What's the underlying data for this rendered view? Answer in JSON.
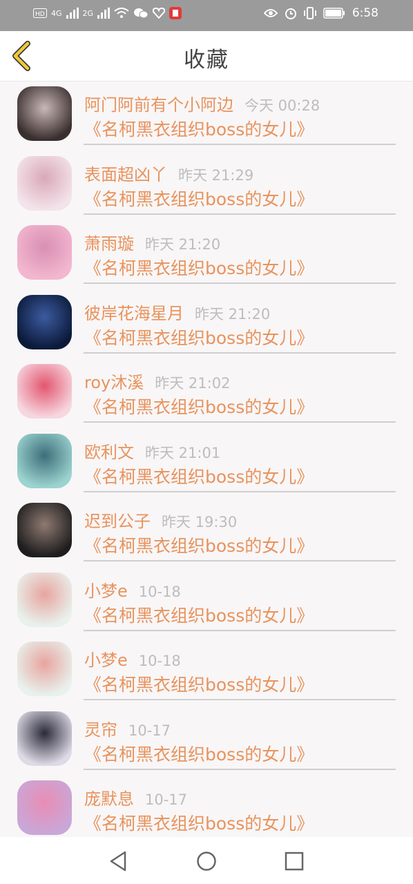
{
  "status_bar": {
    "network_1": "4G",
    "network_2": "2G",
    "time": "6:58",
    "icons": [
      "hd-icon",
      "signal-icon",
      "wifi-icon",
      "wechat-icon",
      "heart-icon",
      "app-icon",
      "eye-icon",
      "alarm-icon",
      "vibrate-icon",
      "battery-icon"
    ]
  },
  "header": {
    "title": "收藏",
    "back_icon": "chevron-left-icon"
  },
  "items": [
    {
      "name": "阿门阿前有个小阿边",
      "time": "今天 00:28",
      "book": "《名柯黑衣组织boss的女儿》",
      "avatar_colors": [
        "#3a2f2f",
        "#c9b8b6"
      ]
    },
    {
      "name": "表面超凶丫",
      "time": "昨天 21:29",
      "book": "《名柯黑衣组织boss的女儿》",
      "avatar_colors": [
        "#f3e3ea",
        "#d9a9b8"
      ]
    },
    {
      "name": "萧雨璇",
      "time": "昨天 21:20",
      "book": "《名柯黑衣组织boss的女儿》",
      "avatar_colors": [
        "#f2b7cf",
        "#d98fb3"
      ]
    },
    {
      "name": "彼岸花海星月",
      "time": "昨天 21:20",
      "book": "《名柯黑衣组织boss的女儿》",
      "avatar_colors": [
        "#0c1a3a",
        "#3b5ba0"
      ]
    },
    {
      "name": "roy沐溪",
      "time": "昨天 21:02",
      "book": "《名柯黑衣组织boss的女儿》",
      "avatar_colors": [
        "#f6d7e0",
        "#e3566f"
      ]
    },
    {
      "name": "欧利文",
      "time": "昨天 21:01",
      "book": "《名柯黑衣组织boss的女儿》",
      "avatar_colors": [
        "#9bd3cf",
        "#3d6e7a"
      ]
    },
    {
      "name": "迟到公子",
      "time": "昨天 19:30",
      "book": "《名柯黑衣组织boss的女儿》",
      "avatar_colors": [
        "#1e1e1e",
        "#8f7a72"
      ]
    },
    {
      "name": "小梦e",
      "time": "10-18",
      "book": "《名柯黑衣组织boss的女儿》",
      "avatar_colors": [
        "#e8f1ec",
        "#e8a49f"
      ]
    },
    {
      "name": "小梦e",
      "time": "10-18",
      "book": "《名柯黑衣组织boss的女儿》",
      "avatar_colors": [
        "#e8f1ec",
        "#e8a49f"
      ]
    },
    {
      "name": "灵帘",
      "time": "10-17",
      "book": "《名柯黑衣组织boss的女儿》",
      "avatar_colors": [
        "#dedbe6",
        "#2b2a3a"
      ]
    },
    {
      "name": "庞默息",
      "time": "10-17",
      "book": "《名柯黑衣组织boss的女儿》",
      "avatar_colors": [
        "#c9a7d8",
        "#e98db4"
      ]
    }
  ],
  "nav_bar": {
    "back_icon": "triangle-back-icon",
    "home_icon": "circle-home-icon",
    "recents_icon": "square-recents-icon"
  },
  "colors": {
    "accent": "#e8935d",
    "back_arrow": "#f0c93a",
    "time": "#bdbdbd",
    "status_bar": "#9b9b9b"
  }
}
